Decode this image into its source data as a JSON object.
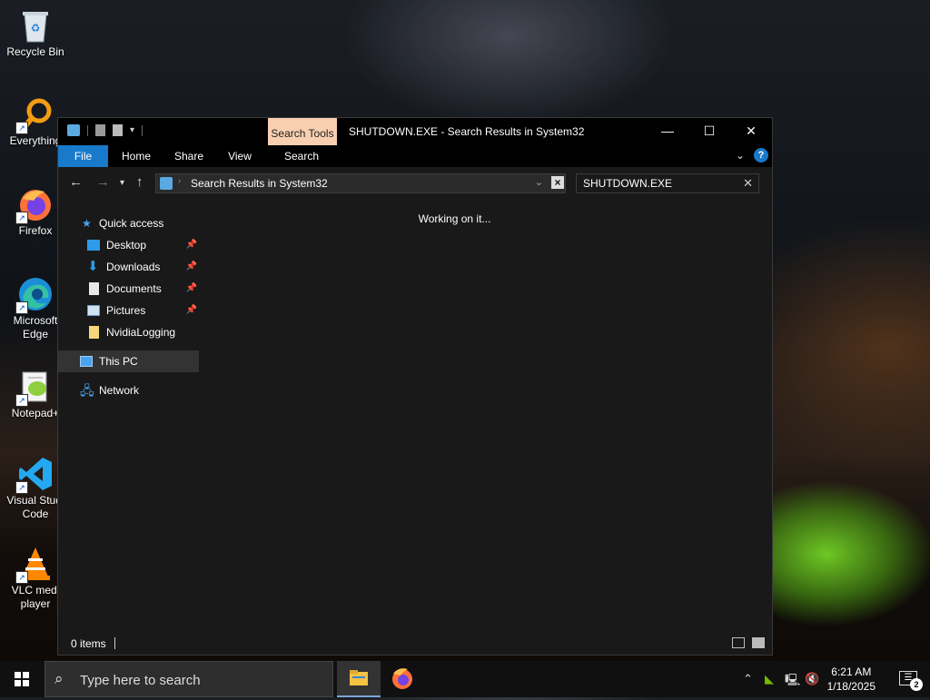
{
  "desktop": {
    "icons": [
      {
        "label": "Recycle Bin",
        "icon": "recycle-bin-icon"
      },
      {
        "label": "Everything",
        "icon": "everything-icon"
      },
      {
        "label": "Firefox",
        "icon": "firefox-icon"
      },
      {
        "label": "Microsoft\nEdge",
        "icon": "edge-icon"
      },
      {
        "label": "Notepad+",
        "icon": "notepadpp-icon"
      },
      {
        "label": "Visual Studi\nCode",
        "icon": "vscode-icon"
      },
      {
        "label": "VLC medi\nplayer",
        "icon": "vlc-icon"
      }
    ]
  },
  "explorer": {
    "title": "SHUTDOWN.EXE - Search Results in System32",
    "context_tab": "Search Tools",
    "ribbon_tabs": [
      "File",
      "Home",
      "Share",
      "View",
      "Search"
    ],
    "address": {
      "breadcrumb": "Search Results in System32"
    },
    "search": {
      "value": "SHUTDOWN.EXE"
    },
    "nav": {
      "quick_access": "Quick access",
      "items": [
        {
          "label": "Desktop",
          "pinned": true
        },
        {
          "label": "Downloads",
          "pinned": true
        },
        {
          "label": "Documents",
          "pinned": true
        },
        {
          "label": "Pictures",
          "pinned": true
        },
        {
          "label": "NvidiaLogging",
          "pinned": false
        }
      ],
      "this_pc": "This PC",
      "network": "Network"
    },
    "content_message": "Working on it...",
    "status": {
      "item_count": "0 items"
    }
  },
  "taskbar": {
    "search_placeholder": "Type here to search",
    "clock": {
      "time": "6:21 AM",
      "date": "1/18/2025"
    },
    "notification_count": "2"
  },
  "colors": {
    "accent": "#1979ca",
    "search_tools_tab": "#f9cfb1",
    "window_bg": "#191919"
  }
}
